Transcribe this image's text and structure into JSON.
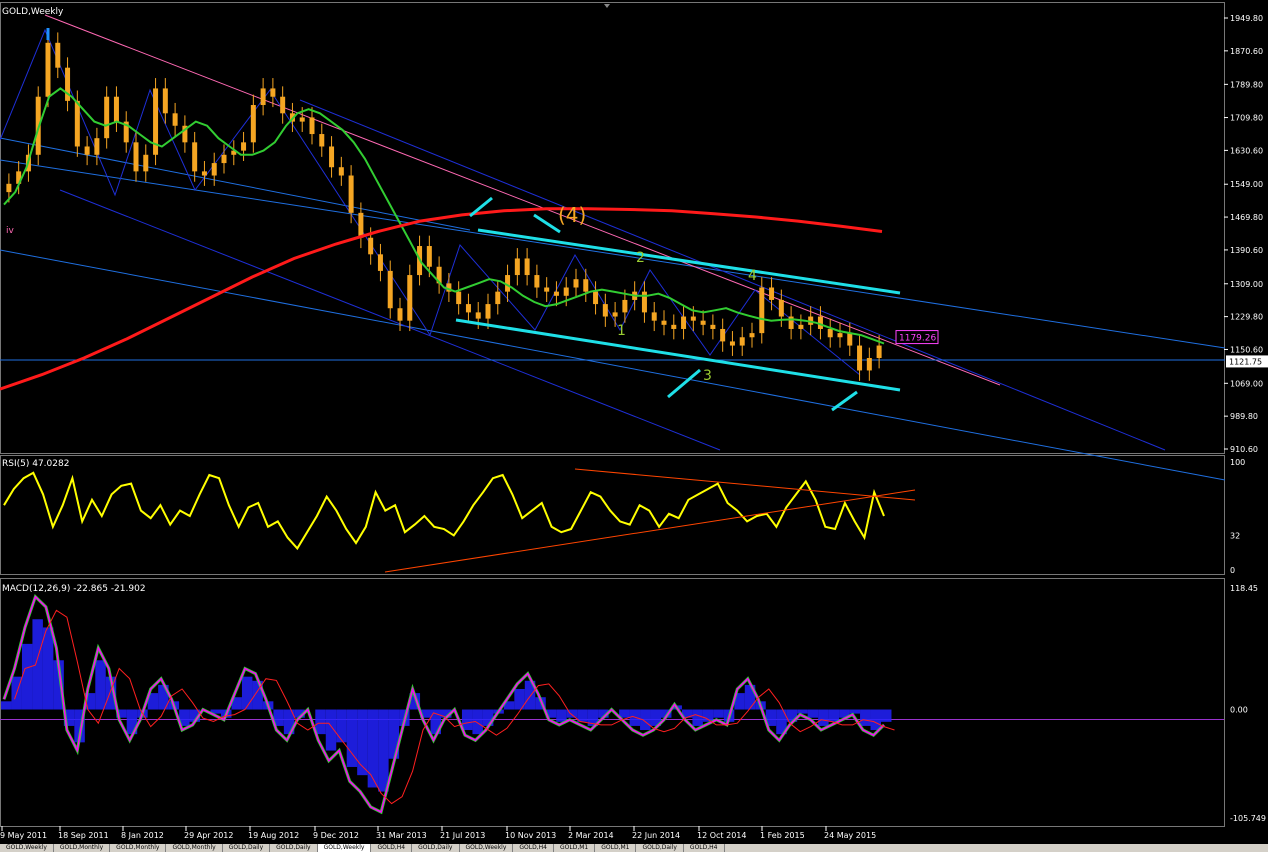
{
  "chart_data": {
    "type": "candlestick",
    "symbol_label": "GOLD,Weekly",
    "colors": {
      "background": "#000000",
      "candle": "#f5a623",
      "ma_short": "#32cd32",
      "ma_long": "#ff1a1a",
      "channel": "#1e2fd6",
      "fib_line": "#1f6fe0",
      "resistance": "#ff69b4",
      "cyan": "#1fe0e8",
      "wave_label": "#9acd32",
      "rsi": "#ffff00",
      "rsi_trend": "#ff4500",
      "macd_hist": "#2222ff",
      "macd_line": "#ff00ff",
      "macd_signal": "#ff2020",
      "macd_main": "#32cd32",
      "axis_text": "#ffffff",
      "price_tag": "#ffffff",
      "target_tag": "#ff44ff"
    },
    "x_labels": [
      "9 May 2011",
      "18 Sep 2011",
      "8 Jan 2012",
      "29 Apr 2012",
      "19 Aug 2012",
      "9 Dec 2012",
      "31 Mar 2013",
      "21 Jul 2013",
      "10 Nov 2013",
      "2 Mar 2014",
      "22 Jun 2014",
      "12 Oct 2014",
      "1 Feb 2015",
      "24 May 2015"
    ],
    "price_axis": {
      "ticks": [
        "1949.80",
        "1870.60",
        "1789.80",
        "1709.80",
        "1630.60",
        "1549.00",
        "1469.80",
        "1390.60",
        "1309.00",
        "1229.80",
        "1150.60",
        "1069.00",
        "989.80",
        "910.60"
      ],
      "min": 910.6,
      "max": 1949.8,
      "current_label": "1121.75",
      "current": 1121.75
    },
    "target_label": "1179.26",
    "target_value": 1179.26,
    "wave_labels": [
      "(4)",
      "1",
      "2",
      "3",
      "4",
      "iv"
    ],
    "price_series": [
      1550,
      1580,
      1620,
      1760,
      1890,
      1830,
      1750,
      1640,
      1620,
      1660,
      1760,
      1700,
      1650,
      1580,
      1620,
      1780,
      1720,
      1690,
      1650,
      1580,
      1570,
      1600,
      1620,
      1630,
      1650,
      1740,
      1780,
      1760,
      1720,
      1700,
      1710,
      1670,
      1640,
      1590,
      1570,
      1480,
      1420,
      1380,
      1340,
      1250,
      1220,
      1330,
      1400,
      1350,
      1310,
      1290,
      1260,
      1240,
      1225,
      1260,
      1290,
      1330,
      1370,
      1330,
      1300,
      1290,
      1280,
      1300,
      1320,
      1290,
      1260,
      1230,
      1240,
      1270,
      1290,
      1240,
      1220,
      1210,
      1200,
      1230,
      1220,
      1210,
      1200,
      1170,
      1160,
      1180,
      1190,
      1300,
      1270,
      1230,
      1200,
      1210,
      1230,
      1200,
      1180,
      1190,
      1160,
      1100,
      1130,
      1160
    ],
    "ma_short": [
      1500,
      1530,
      1590,
      1680,
      1760,
      1780,
      1760,
      1730,
      1700,
      1690,
      1700,
      1690,
      1670,
      1650,
      1640,
      1660,
      1680,
      1700,
      1690,
      1660,
      1640,
      1620,
      1620,
      1630,
      1650,
      1690,
      1720,
      1730,
      1720,
      1700,
      1680,
      1650,
      1610,
      1560,
      1510,
      1460,
      1410,
      1360,
      1330,
      1300,
      1290,
      1300,
      1310,
      1320,
      1315,
      1300,
      1280,
      1265,
      1255,
      1260,
      1270,
      1280,
      1290,
      1295,
      1290,
      1285,
      1280,
      1280,
      1285,
      1275,
      1260,
      1245,
      1240,
      1245,
      1250,
      1240,
      1232,
      1225,
      1220,
      1222,
      1223,
      1220,
      1215,
      1205,
      1195,
      1190,
      1185,
      1175,
      1165
    ],
    "ma_long": [
      1055,
      1090,
      1130,
      1175,
      1225,
      1275,
      1325,
      1370,
      1405,
      1435,
      1460,
      1475,
      1485,
      1490,
      1490,
      1488,
      1485,
      1478,
      1470,
      1460,
      1448,
      1435
    ],
    "rsi": {
      "label": "RSI(5) 47.0282",
      "value": 47.0282,
      "ticks": [
        "100",
        "32",
        "0"
      ],
      "min": 0,
      "max": 100,
      "series": [
        60,
        75,
        85,
        90,
        70,
        40,
        60,
        85,
        45,
        65,
        50,
        70,
        78,
        80,
        55,
        48,
        60,
        42,
        55,
        50,
        70,
        88,
        85,
        60,
        40,
        58,
        62,
        40,
        45,
        30,
        20,
        35,
        50,
        68,
        55,
        38,
        25,
        40,
        72,
        55,
        60,
        35,
        42,
        50,
        40,
        38,
        32,
        45,
        60,
        72,
        85,
        88,
        70,
        48,
        55,
        62,
        40,
        35,
        38,
        55,
        72,
        68,
        55,
        45,
        42,
        60,
        55,
        40,
        52,
        48,
        65,
        70,
        75,
        80,
        62,
        55,
        45,
        50,
        52,
        40,
        58,
        70,
        82,
        65,
        40,
        38,
        62,
        45,
        30,
        72,
        50
      ],
      "trend_lines": [
        {
          "name": "rsi-support"
        },
        {
          "name": "rsi-resistance"
        }
      ]
    },
    "macd": {
      "label": "MACD(12,26,9) -22.865 -21.902",
      "main": -22.865,
      "signal": -21.902,
      "ticks": [
        "118.45",
        "0.00",
        "-105.749"
      ],
      "min": -105.749,
      "max": 118.45,
      "series": [
        10,
        40,
        80,
        110,
        100,
        60,
        -20,
        -40,
        20,
        60,
        40,
        -10,
        -30,
        -10,
        20,
        30,
        10,
        -20,
        -15,
        0,
        -5,
        -10,
        15,
        40,
        35,
        10,
        -20,
        -30,
        -10,
        0,
        -30,
        -50,
        -40,
        -70,
        -80,
        -95,
        -100,
        -60,
        -20,
        20,
        -10,
        -30,
        -10,
        0,
        -25,
        -30,
        -20,
        -5,
        10,
        25,
        35,
        15,
        -10,
        -15,
        -10,
        -15,
        -20,
        -10,
        0,
        -10,
        -20,
        -25,
        -20,
        -10,
        5,
        -10,
        -20,
        -15,
        -10,
        -15,
        20,
        30,
        10,
        -20,
        -30,
        -15,
        -5,
        -10,
        -20,
        -15,
        -10,
        -5,
        -20,
        -25,
        -15
      ]
    },
    "annotations": []
  },
  "tabs": [
    "GOLD,Weekly",
    "GOLD,Monthly",
    "GOLD,Monthly",
    "GOLD,Monthly",
    "GOLD,Daily",
    "GOLD,Daily",
    "GOLD,Weekly",
    "GOLD,H4",
    "GOLD,Daily",
    "GOLD,Weekly",
    "GOLD,H4",
    "GOLD,M1",
    "GOLD,M1",
    "GOLD,Daily",
    "GOLD,H4"
  ]
}
